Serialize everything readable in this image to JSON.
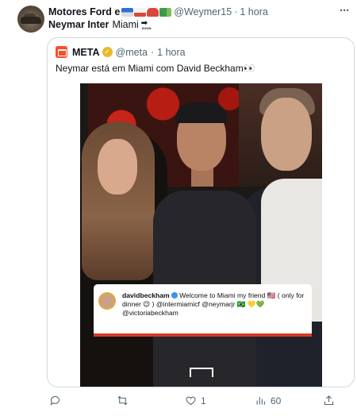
{
  "post": {
    "author_name": "Motores Ford e",
    "author_emojis": [
      "police-car",
      "ambulance",
      "red-car",
      "truck"
    ],
    "handle": "@Weymer15",
    "separator": "·",
    "time": "1 hora",
    "text_bold": "Neymar Inter",
    "text_normal": "Miami",
    "soon_emoji_text": "SOON",
    "more_label": "···"
  },
  "quote": {
    "author_name": "META",
    "verified_badge": "✓",
    "handle": "@meta",
    "separator": "·",
    "time": "1 hora",
    "text": "Neymar está em Miami com David Beckham👀",
    "instagram_caption": {
      "username": "davidbeckham",
      "message": " Welcome to Miami my friend 🇺🇸 ( only for dinner 😉 ) @intermiamicf @neymarjr 🇧🇷 💛💚 @victoriabeckham"
    }
  },
  "actions": {
    "reply_count": "",
    "retweet_count": "",
    "like_count": "1",
    "views_count": "60"
  },
  "colors": {
    "text_primary": "#0f1419",
    "text_secondary": "#536471",
    "border": "#cfd9de",
    "accent_logo": "#ff4b26",
    "verified_gold": "#e8b92e"
  }
}
